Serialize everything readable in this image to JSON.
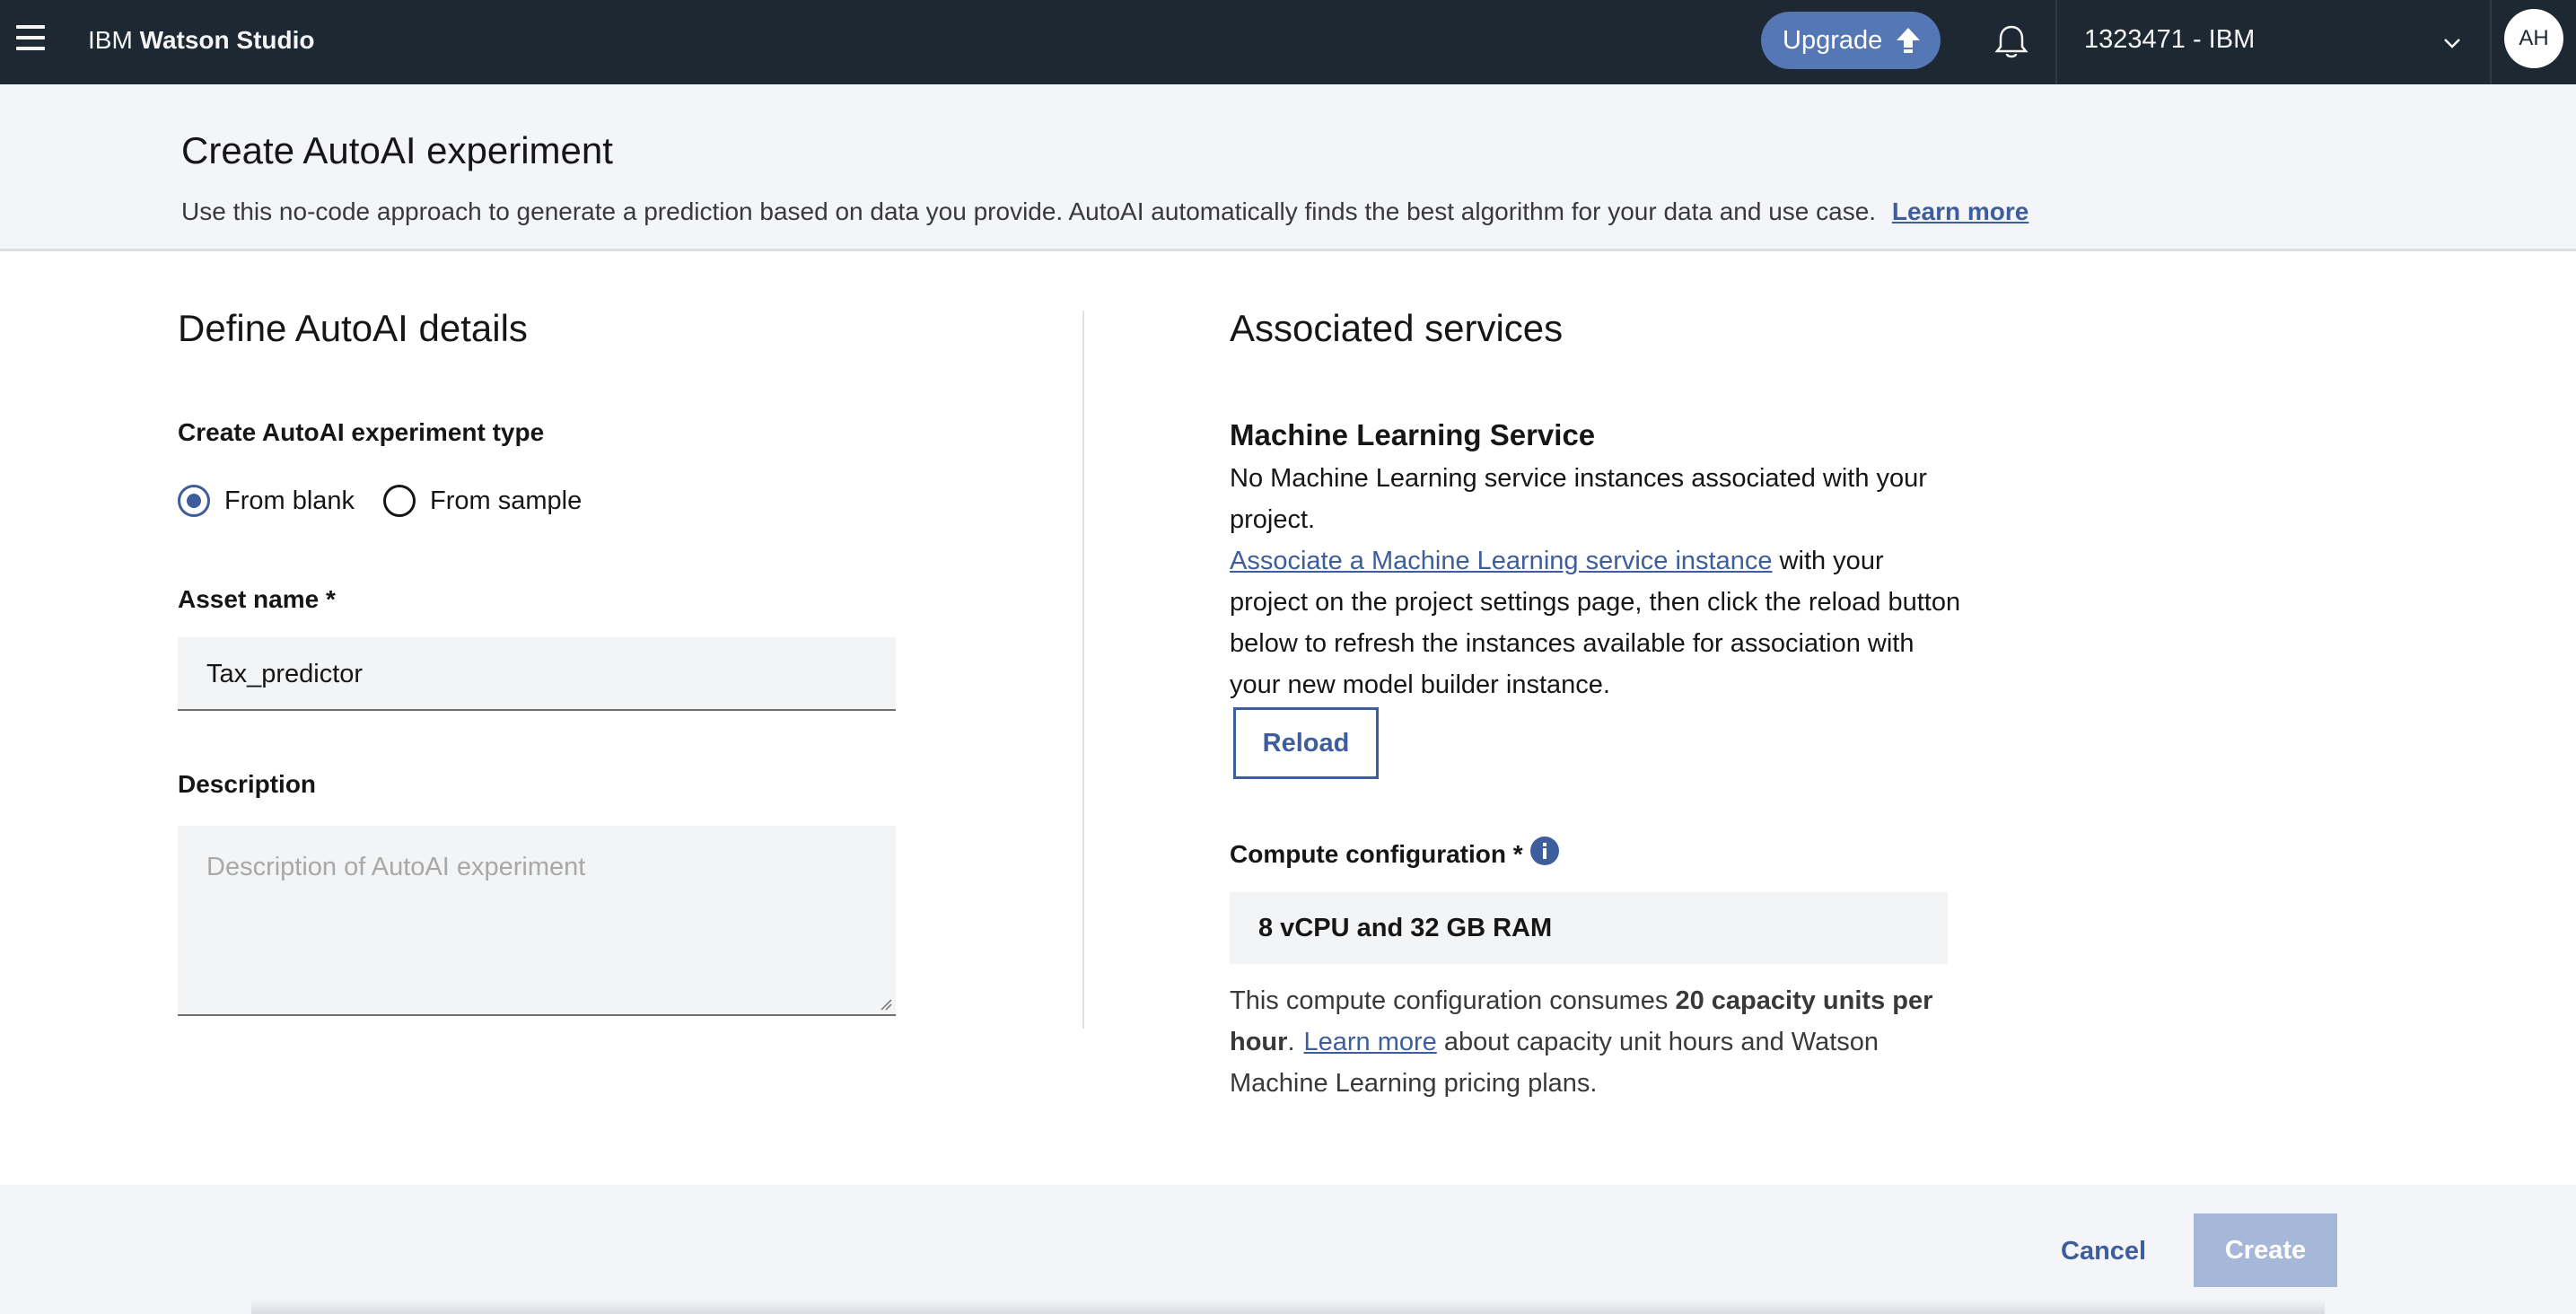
{
  "topbar": {
    "brand_prefix": "IBM",
    "brand_name": "Watson Studio",
    "upgrade_label": "Upgrade",
    "account_label": "1323471 - IBM",
    "avatar_initials": "AH"
  },
  "header": {
    "title": "Create AutoAI experiment",
    "description": "Use this no-code approach to generate a prediction based on data you provide.  AutoAI automatically finds the best algorithm for your data and use case.",
    "learn_more": "Learn more"
  },
  "details": {
    "title": "Define AutoAI details",
    "type_label": "Create AutoAI experiment type",
    "options": [
      {
        "label": "From blank",
        "selected": true
      },
      {
        "label": "From sample",
        "selected": false
      }
    ],
    "asset_name_label": "Asset name *",
    "asset_name_value": "Tax_predictor",
    "description_label": "Description",
    "description_placeholder": "Description of AutoAI experiment"
  },
  "services": {
    "title": "Associated services",
    "ml_title": "Machine Learning Service",
    "ml_message": "No Machine Learning service instances associated with your project.",
    "associate_link": "Associate a Machine Learning service instance",
    "associate_rest": " with your project on the project settings page, then click the reload button below to refresh the instances available for association with your new model builder instance.",
    "reload_label": "Reload",
    "compute_label": "Compute configuration *",
    "compute_value": "8 vCPU and 32 GB RAM",
    "compute_note_pre": "This compute configuration consumes ",
    "compute_note_bold": "20 capacity units per hour",
    "compute_note_dot": ".",
    "compute_learn_more": "Learn more",
    "compute_note_post": " about capacity unit hours and Watson Machine Learning pricing plans."
  },
  "footer": {
    "cancel_label": "Cancel",
    "create_label": "Create"
  },
  "colors": {
    "topbar_bg": "#1e2833",
    "accent": "#3e5d9c",
    "upgrade_bg": "#5577b5",
    "create_disabled_bg": "#a6b8d8"
  },
  "icons": [
    "hamburger-menu-icon",
    "upgrade-arrow-icon",
    "notification-bell-icon",
    "chevron-down-icon",
    "info-icon",
    "resize-handle-icon"
  ]
}
